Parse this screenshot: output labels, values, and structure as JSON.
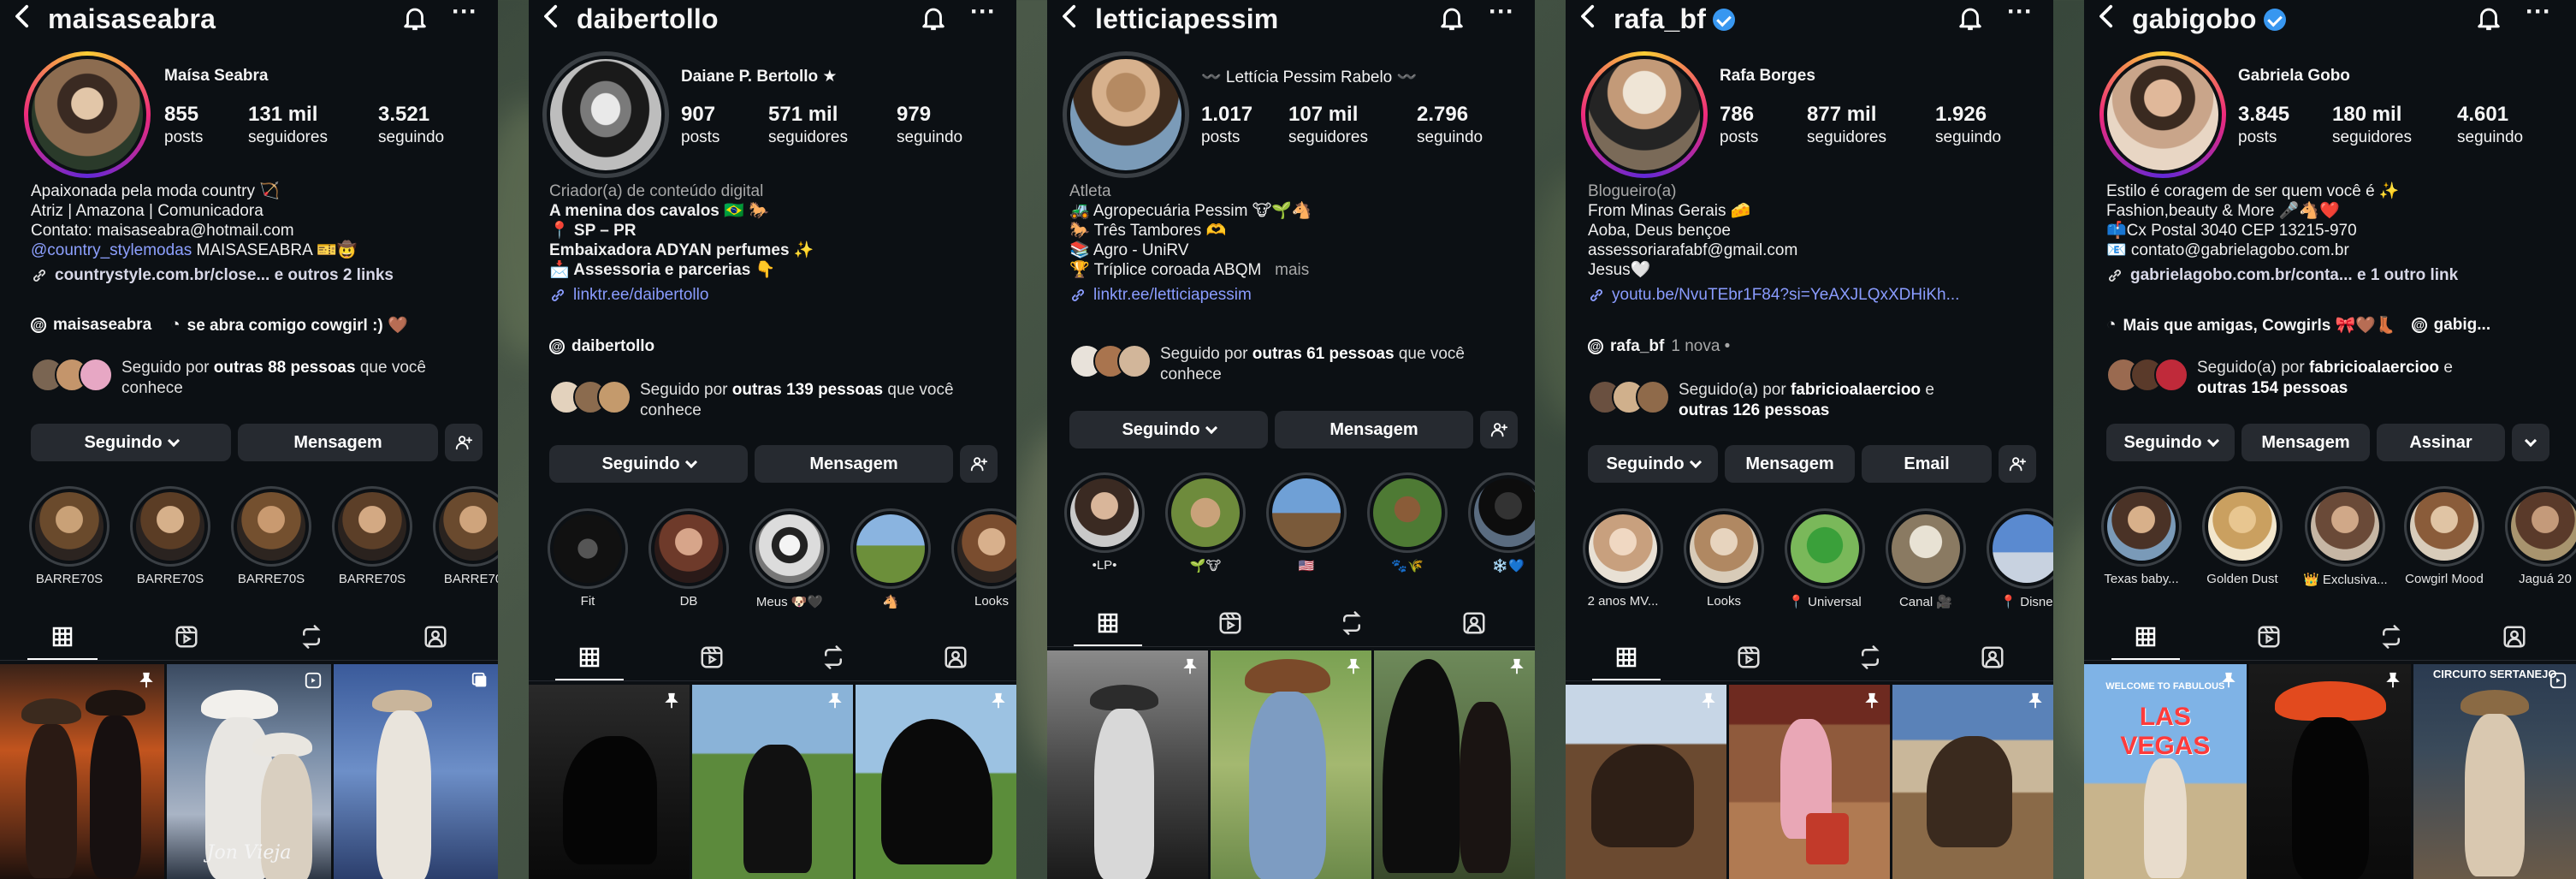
{
  "profiles": [
    {
      "username": "maisaseabra",
      "verified": false,
      "full_name": "Maísa Seabra",
      "posts": "855",
      "posts_label": "posts",
      "followers": "131 mil",
      "followers_label": "seguidores",
      "following": "3.521",
      "following_label": "seguindo",
      "bio": [
        "Apaixonada pela moda country 🏹",
        "Atriz | Amazona | Comunicadora",
        "Contato: maisaseabra@hotmail.com"
      ],
      "mention": "@country_stylemodas",
      "mention_tail": "MAISASEABRA 🎫🤠",
      "link": "countrystyle.com.br/close... e outros 2 links",
      "threads_user": "maisaseabra",
      "threads_extra": "se abra comigo cowgirl :) 🤎",
      "followed_by": "Seguido por",
      "followed_by_bold": "outras 88 pessoas",
      "followed_by_tail": "que você conhece",
      "button1": "Seguindo",
      "button2": "Mensagem",
      "highlights": [
        "BARRE70S",
        "BARRE70S",
        "BARRE70S",
        "BARRE70S",
        "BARRE70"
      ]
    },
    {
      "username": "daibertollo",
      "verified": false,
      "full_name": "Daiane P. Bertollo ★",
      "posts": "907",
      "posts_label": "posts",
      "followers": "571 mil",
      "followers_label": "seguidores",
      "following": "979",
      "following_label": "seguindo",
      "category": "Criador(a) de conteúdo digital",
      "bio": [
        "A menina dos cavalos 🇧🇷 🐎",
        "📍 SP – PR",
        "Embaixadora ADYAN perfumes ✨",
        "📩 Assessoria e parcerias 👇"
      ],
      "link": "linktr.ee/daibertollo",
      "threads_user": "daibertollo",
      "followed_by": "Seguido por",
      "followed_by_bold": "outras 139 pessoas",
      "followed_by_tail": "que você conhece",
      "button1": "Seguindo",
      "button2": "Mensagem",
      "highlights": [
        "Fit",
        "DB",
        "Meus 🐶🖤",
        "🐴",
        "Looks"
      ]
    },
    {
      "username": "letticiapessim",
      "verified": false,
      "full_name": "〰️ Lettícia Pessim Rabelo 〰️",
      "posts": "1.017",
      "posts_label": "posts",
      "followers": "107 mil",
      "followers_label": "seguidores",
      "following": "2.796",
      "following_label": "seguindo",
      "category": "Atleta",
      "bio": [
        "🚜 Agropecuária Pessim 🐮🌱🐴",
        "🐎 Três Tambores 🫶",
        "📚 Agro - UniRV",
        "🏆 Tríplice coroada ABQM"
      ],
      "more": "mais",
      "link": "linktr.ee/letticiapessim",
      "followed_by": "Seguido por",
      "followed_by_bold": "outras 61 pessoas",
      "followed_by_tail": "que você conhece",
      "button1": "Seguindo",
      "button2": "Mensagem",
      "highlights": [
        "•LP•",
        "🌱🐮",
        "🇺🇸",
        "🐾🌾",
        "❄️💙"
      ]
    },
    {
      "username": "rafa_bf",
      "verified": true,
      "full_name": "Rafa Borges",
      "posts": "786",
      "posts_label": "posts",
      "followers": "877 mil",
      "followers_label": "seguidores",
      "following": "1.926",
      "following_label": "seguindo",
      "category": "Blogueiro(a)",
      "bio": [
        "From Minas Gerais 🧀",
        "Aoba, Deus bençoe",
        "assessoriarafabf@gmail.com",
        "Jesus🤍"
      ],
      "link": "youtu.be/NvuTEbr1F84?si=YeAXJLQxXDHiKh...",
      "threads_user": "rafa_bf",
      "threads_extra": "1 nova •",
      "followed_by": "Seguido(a) por",
      "followed_by_bold": "fabricioalaercioo",
      "followed_by_tail": "e",
      "followed_by_bold2": "outras 126 pessoas",
      "button1": "Seguindo",
      "button2": "Mensagem",
      "button3": "Email",
      "highlights": [
        "2 anos MV...",
        "Looks",
        "📍 Universal",
        "Canal 🎥",
        "📍 Disne"
      ]
    },
    {
      "username": "gabigobo",
      "verified": true,
      "full_name": "Gabriela Gobo",
      "posts": "3.845",
      "posts_label": "posts",
      "followers": "180 mil",
      "followers_label": "seguidores",
      "following": "4.601",
      "following_label": "seguindo",
      "bio": [
        "Estilo é coragem de ser quem você é ✨",
        "Fashion,beauty & More 🎤🐴❤️",
        "📫Cx Postal 3040 CEP 13215-970",
        "📧 contato@gabrielagobo.com.br"
      ],
      "link": "gabrielagobo.com.br/conta... e 1 outro link",
      "threads_extra": "Mais que amigas, Cowgirls 🎀🤎👢",
      "threads_user": "gabig...",
      "followed_by": "Seguido(a) por",
      "followed_by_bold": "fabricioalaercioo",
      "followed_by_tail": "e",
      "followed_by_bold2": "outras 154 pessoas",
      "button1": "Seguindo",
      "button2": "Mensagem",
      "button3": "Assinar",
      "highlights": [
        "Texas baby...",
        "Golden Dust",
        "👑 Exclusiva...",
        "Cowgirl Mood",
        "Jaguá 20"
      ]
    }
  ],
  "grid_texts": {
    "p1_caption": "Jon Vieja",
    "p5_vegas": "LAS VEGAS",
    "p5_welcome": "WELCOME TO FABULOUS",
    "p5_circuito": "CIRCUITO SERTANEJO"
  },
  "colors": {
    "background": "#0c1014",
    "button": "#262a30",
    "link": "#8a9cff",
    "verified": "#3897f0"
  }
}
